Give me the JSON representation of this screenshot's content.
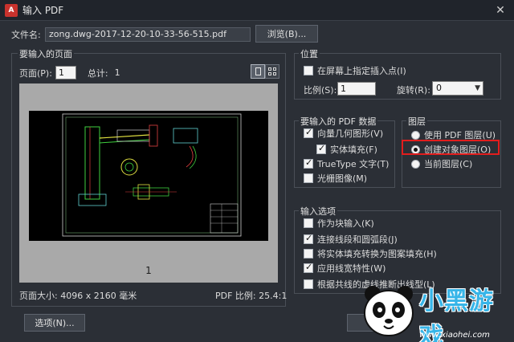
{
  "window": {
    "title": "输入 PDF",
    "app_icon": "A",
    "close_label": "✕"
  },
  "file": {
    "label": "文件名:",
    "value": "zong.dwg-2017-12-20-10-33-56-515.pdf",
    "browse_label": "浏览(B)..."
  },
  "pages_section": {
    "title": "要输入的页面",
    "page_label": "页面(P):",
    "page_value": "1",
    "total_label": "总计:",
    "total_value": "1",
    "preview_page_number": "1",
    "page_size_label": "页面大小: 4096 x 2160 毫米",
    "pdf_ratio_label": "PDF 比例: 25.4:1"
  },
  "position_section": {
    "title": "位置",
    "specify_on_screen": {
      "label": "在屏幕上指定插入点(I)",
      "checked": false
    },
    "scale_label": "比例(S):",
    "scale_value": "1",
    "rotation_label": "旋转(R):",
    "rotation_value": "0"
  },
  "pdf_data_section": {
    "title": "要输入的 PDF 数据",
    "items": [
      {
        "label": "向量几何图形(V)",
        "checked": true
      },
      {
        "label": "实体填充(F)",
        "checked": true
      },
      {
        "label": "TrueType 文字(T)",
        "checked": true
      },
      {
        "label": "光栅图像(M)",
        "checked": false
      }
    ]
  },
  "layers_section": {
    "title": "图层",
    "options": [
      {
        "label": "使用 PDF 图层(U)",
        "checked": false
      },
      {
        "label": "创建对象图层(O)",
        "checked": true
      },
      {
        "label": "当前图层(C)",
        "checked": false
      }
    ]
  },
  "import_options_section": {
    "title": "输入选项",
    "items": [
      {
        "label": "作为块输入(K)",
        "checked": false
      },
      {
        "label": "连接线段和圆弧段(J)",
        "checked": true
      },
      {
        "label": "将实体填充转换为图案填充(H)",
        "checked": false
      },
      {
        "label": "应用线宽特性(W)",
        "checked": true
      },
      {
        "label": "根据共线的虚线推断出线型(L)",
        "checked": false
      }
    ]
  },
  "buttons": {
    "options_label": "选项(N)..."
  },
  "watermark": {
    "brand": "小黑游戏",
    "url": "www.xiaohei.com"
  },
  "colors": {
    "accent_red": "#e21d1d",
    "dialog_bg": "#2b2f36",
    "preview_bg": "#a9a9a9"
  }
}
